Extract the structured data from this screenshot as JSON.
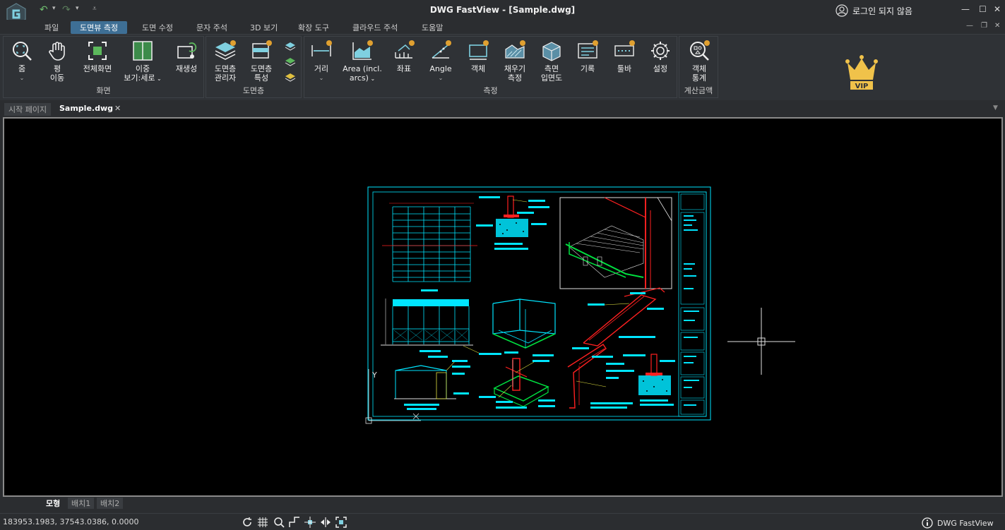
{
  "window": {
    "title": "DWG FastView - [Sample.dwg]",
    "login_label": "로그인 되지 않음"
  },
  "menu": {
    "tabs": [
      "파일",
      "도면뷰 측정",
      "도면 수정",
      "문자 주석",
      "3D 보기",
      "확장 도구",
      "클라우드 주석",
      "도움말"
    ],
    "active": "도면뷰 측정"
  },
  "ribbon": {
    "view_panel": {
      "label": "화면",
      "zoom": "줌",
      "pan": [
        "평",
        "이동"
      ],
      "full_screen": "전체화면",
      "dual_view": [
        "이중",
        "보기:세로"
      ],
      "regen": "재생성"
    },
    "layer_panel": {
      "label": "도면층",
      "layer_manager": [
        "도면층",
        "관리자"
      ],
      "layer_props": [
        "도면층",
        "특성"
      ]
    },
    "measure_panel": {
      "label": "측정",
      "distance": "거리",
      "area": [
        "Area (incl.",
        "arcs)"
      ],
      "coord": "좌표",
      "angle": "Angle",
      "object": "객체",
      "fill_measure": [
        "채우기",
        "측정"
      ],
      "side_elevation": [
        "측면",
        "입면도"
      ],
      "record": "기록",
      "toolbar": "툴바",
      "settings": "설정"
    },
    "calc_panel": {
      "label": "계산금액",
      "object_stats": [
        "객체",
        "통계"
      ]
    },
    "vip_label": "VIP"
  },
  "doc_tabs": {
    "start_page": "시작 페이지",
    "current": "Sample.dwg",
    "close": "✕"
  },
  "layout_tabs": [
    "모형",
    "배치1",
    "배치2"
  ],
  "status": {
    "coordinates": "183953.1983, 37543.0386, 0.0000",
    "brand": "DWG FastView"
  },
  "colors": {
    "accent": "#3e6f95",
    "canvas": "#000000",
    "cad_cyan": "#00e5ff",
    "cad_red": "#ff2020",
    "cad_green": "#00e040",
    "vip_gold": "#f0c24a"
  }
}
